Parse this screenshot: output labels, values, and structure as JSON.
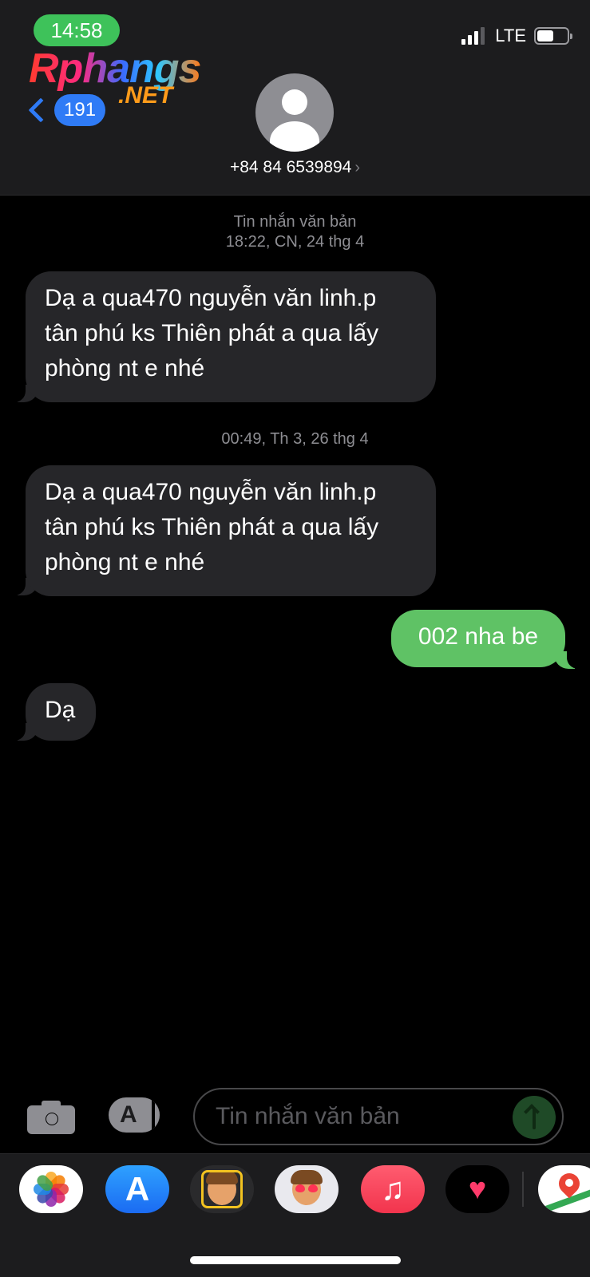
{
  "status_bar": {
    "time": "14:58",
    "network": "LTE",
    "signal_bars_active": 3,
    "signal_bars_total": 4,
    "battery_level": 0.55
  },
  "watermark": {
    "main": "Rphangs",
    "sub": ".NET"
  },
  "header": {
    "back_count": "191",
    "contact": "+84 84 6539894",
    "contact_chevron": "›"
  },
  "conversation": {
    "stamps": [
      {
        "service": "Tin nhắn văn bản",
        "time": "18:22, CN, 24 thg 4"
      },
      {
        "time": "00:49, Th 3, 26 thg 4"
      }
    ],
    "messages": [
      {
        "direction": "incoming",
        "lines": [
          "Dạ a qua470 nguyễn văn linh.p",
          "tân phú ks Thiên phát a qua lấy",
          "phòng nt e nhé"
        ]
      },
      {
        "direction": "incoming",
        "lines": [
          "Dạ a qua470 nguyễn văn linh.p",
          "tân phú ks Thiên phát a qua lấy",
          "phòng nt e nhé"
        ]
      },
      {
        "direction": "outgoing",
        "text": "002 nha be"
      },
      {
        "direction": "incoming",
        "text": "Dạ"
      }
    ]
  },
  "compose": {
    "placeholder": "Tin nhắn văn bản",
    "camera_icon": "camera-icon",
    "apps_icon": "app-store-icon",
    "send_icon": "arrow-up-icon"
  },
  "app_drawer": {
    "apps": [
      "photos",
      "app-store",
      "memoji",
      "memoji-stickers",
      "music",
      "digital-touch",
      "maps"
    ]
  },
  "colors": {
    "incoming_bubble": "#262629",
    "outgoing_bubble": "#5fc265",
    "accent": "#2f7bf6",
    "time_pill": "#3ec25a"
  }
}
